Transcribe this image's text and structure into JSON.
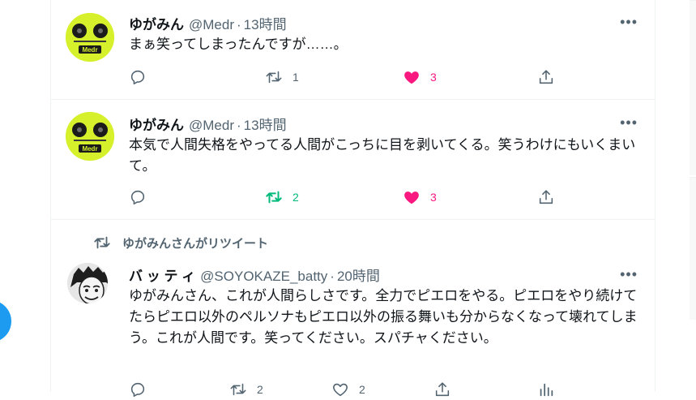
{
  "tweets": [
    {
      "name": "ゆがみん",
      "handle": "@Medr",
      "sep": "·",
      "time": "13時間",
      "text": "まぁ笑ってしまったんですが……。",
      "reply_count": "",
      "retweet_count": "1",
      "like_count": "3",
      "retweeted": false,
      "liked": true,
      "avatar_icon": "effects-pedal-avatar",
      "avatar_label": "Medr"
    },
    {
      "name": "ゆがみん",
      "handle": "@Medr",
      "sep": "·",
      "time": "13時間",
      "text": "本気で人間失格をやってる人間がこっちに目を剥いてくる。笑うわけにもいくまいて。",
      "reply_count": "",
      "retweet_count": "2",
      "like_count": "3",
      "retweeted": true,
      "liked": true,
      "avatar_icon": "effects-pedal-avatar",
      "avatar_label": "Medr"
    },
    {
      "retweeted_by": "ゆがみんさんがリツイート",
      "name": "バ ッ テ ィ",
      "handle": "@SOYOKAZE_batty",
      "sep": "·",
      "time": "20時間",
      "text": "ゆがみんさん、これが人間らしさです。全力でピエロをやる。ピエロをやり続けてたらピエロ以外のペルソナもピエロ以外の振る舞いも分からなくなって壊れてしまう。これが人間です。笑ってください。スパチャください。",
      "reply_count": "",
      "retweet_count": "2",
      "like_count": "2",
      "retweeted": false,
      "liked": false,
      "avatar_icon": "manga-portrait-avatar"
    }
  ],
  "more_glyph": "•••",
  "colors": {
    "accent": "#1d9bf0",
    "retweet_active": "#00ba7c",
    "like_active": "#f91880",
    "muted": "#536471",
    "text": "#0f1419",
    "pedal": "#d6f02b"
  },
  "icons": [
    "reply-icon",
    "retweet-icon",
    "like-icon",
    "share-icon",
    "more-icon",
    "compose-fab-icon"
  ]
}
